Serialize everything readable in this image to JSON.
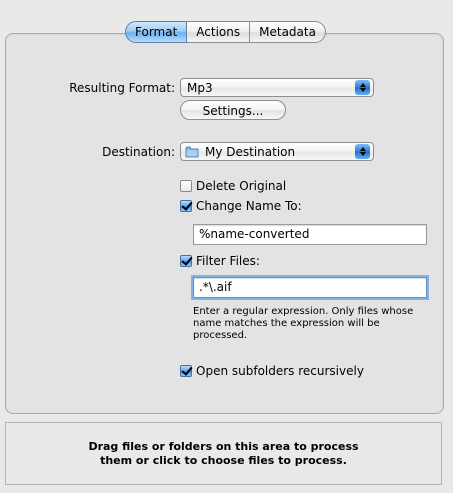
{
  "tabs": [
    "Format",
    "Actions",
    "Metadata"
  ],
  "active_tab": "Format",
  "format": {
    "resulting_format_label": "Resulting Format:",
    "resulting_format_value": "Mp3",
    "settings_button": "Settings...",
    "destination_label": "Destination:",
    "destination_value": "My Destination"
  },
  "options": {
    "delete_original": {
      "label": "Delete Original",
      "checked": false
    },
    "change_name": {
      "label": "Change Name To:",
      "checked": true,
      "value": "%name-converted"
    },
    "filter_files": {
      "label": "Filter Files:",
      "checked": true,
      "value": ".*\\.aif"
    },
    "filter_help": "Enter a regular expression. Only files whose name matches the expression will be processed.",
    "open_subfolders": {
      "label": "Open subfolders recursively",
      "checked": true
    }
  },
  "dropzone": {
    "text": "Drag files or folders on this area to process them or click to choose files to process."
  },
  "icons": {
    "popup_arrows": "popup-arrows-icon",
    "folder": "folder-icon",
    "checkmark": "checkmark-icon"
  },
  "colors": {
    "accent": "#4a90e2",
    "panel_bg": "#e3e3e3",
    "window_bg": "#e9e9e9"
  }
}
